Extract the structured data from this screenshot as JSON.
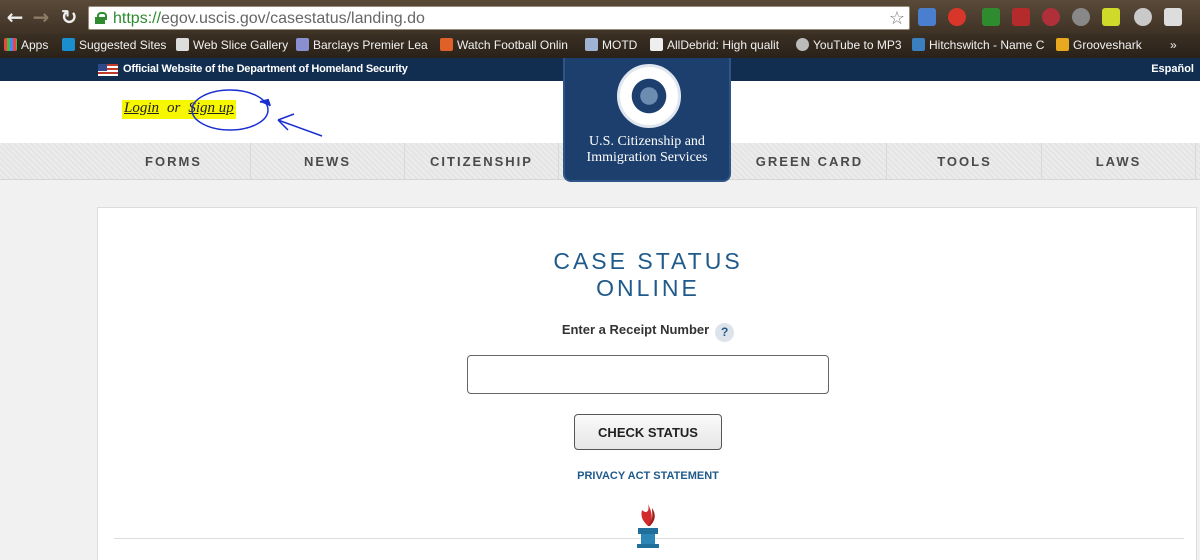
{
  "browser": {
    "url_scheme": "https://",
    "url_rest": "egov.uscis.gov/casestatus/landing.do",
    "back_icon": "back-arrow-icon",
    "forward_icon": "forward-arrow-icon",
    "reload_icon": "reload-icon"
  },
  "bookmarks": {
    "apps": "Apps",
    "items": [
      "Suggested Sites",
      "Web Slice Gallery",
      "Barclays Premier Leag",
      "Watch Football Onlin",
      "MOTD",
      "AllDebrid: High qualit",
      "YouTube to MP3",
      "Hitchswitch - Name C",
      "Grooveshark"
    ],
    "overflow": "»"
  },
  "official": {
    "text": "Official Website of the Department of Homeland Security",
    "espanol": "Español"
  },
  "header": {
    "login": "Login",
    "or": "or",
    "signup": "Sign up",
    "agency_line1": "U.S. Citizenship and",
    "agency_line2": "Immigration Services"
  },
  "nav": {
    "items": [
      "FORMS",
      "NEWS",
      "CITIZENSHIP",
      "GREEN CARD",
      "TOOLS",
      "LAWS"
    ]
  },
  "main": {
    "title_line1": "CASE STATUS",
    "title_line2": "ONLINE",
    "receipt_label": "Enter a Receipt Number",
    "help": "?",
    "receipt_value": "",
    "check_button": "CHECK STATUS",
    "privacy": "PRIVACY ACT STATEMENT"
  },
  "colors": {
    "brand_navy": "#112e51",
    "title_blue": "#1f5a8a",
    "highlight": "#f7f700"
  }
}
